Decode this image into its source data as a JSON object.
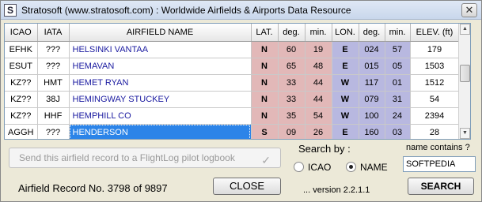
{
  "window": {
    "title": "Stratosoft (www.stratosoft.com) : Worldwide Airfields & Airports Data Resource",
    "icon_letter": "S",
    "close_glyph": "✕"
  },
  "table": {
    "columns": [
      "ICAO",
      "IATA",
      "AIRFIELD NAME",
      "LAT.",
      "deg.",
      "min.",
      "LON.",
      "deg.",
      "min.",
      "ELEV. (ft)"
    ],
    "rows": [
      {
        "icao": "EFHK",
        "iata": "???",
        "name": "HELSINKI VANTAA",
        "lat": "N",
        "lat_deg": "60",
        "lat_min": "19",
        "lon": "E",
        "lon_deg": "024",
        "lon_min": "57",
        "elev": "179"
      },
      {
        "icao": "ESUT",
        "iata": "???",
        "name": "HEMAVAN",
        "lat": "N",
        "lat_deg": "65",
        "lat_min": "48",
        "lon": "E",
        "lon_deg": "015",
        "lon_min": "05",
        "elev": "1503"
      },
      {
        "icao": "KZ??",
        "iata": "HMT",
        "name": "HEMET RYAN",
        "lat": "N",
        "lat_deg": "33",
        "lat_min": "44",
        "lon": "W",
        "lon_deg": "117",
        "lon_min": "01",
        "elev": "1512"
      },
      {
        "icao": "KZ??",
        "iata": "38J",
        "name": "HEMINGWAY STUCKEY",
        "lat": "N",
        "lat_deg": "33",
        "lat_min": "44",
        "lon": "W",
        "lon_deg": "079",
        "lon_min": "31",
        "elev": "54"
      },
      {
        "icao": "KZ??",
        "iata": "HHF",
        "name": "HEMPHILL CO",
        "lat": "N",
        "lat_deg": "35",
        "lat_min": "54",
        "lon": "W",
        "lon_deg": "100",
        "lon_min": "24",
        "elev": "2394"
      },
      {
        "icao": "AGGH",
        "iata": "???",
        "name": "HENDERSON",
        "lat": "S",
        "lat_deg": "09",
        "lat_min": "26",
        "lon": "E",
        "lon_deg": "160",
        "lon_min": "03",
        "elev": "28"
      }
    ],
    "selected_row_index": 5
  },
  "scrollbar": {
    "up_glyph": "▲",
    "down_glyph": "▼"
  },
  "send_button": {
    "label": "Send this airfield record to a FlightLog pilot logbook",
    "check_glyph": "✓"
  },
  "record": {
    "label": "Airfield Record No. 3798 of 9897"
  },
  "buttons": {
    "close": "CLOSE",
    "search": "SEARCH"
  },
  "search": {
    "by_label": "Search by :",
    "icao_label": "ICAO",
    "name_label": "NAME",
    "selected": "NAME",
    "contains_label": "name contains ?",
    "contains_value": "SOFTPEDIA"
  },
  "version": "... version 2.2.1.1",
  "colors": {
    "lat_cells": "#e2b8b8",
    "lon_cells": "#b8b8e0",
    "selection": "#2c84e8",
    "name_text": "#1a1aa0"
  }
}
